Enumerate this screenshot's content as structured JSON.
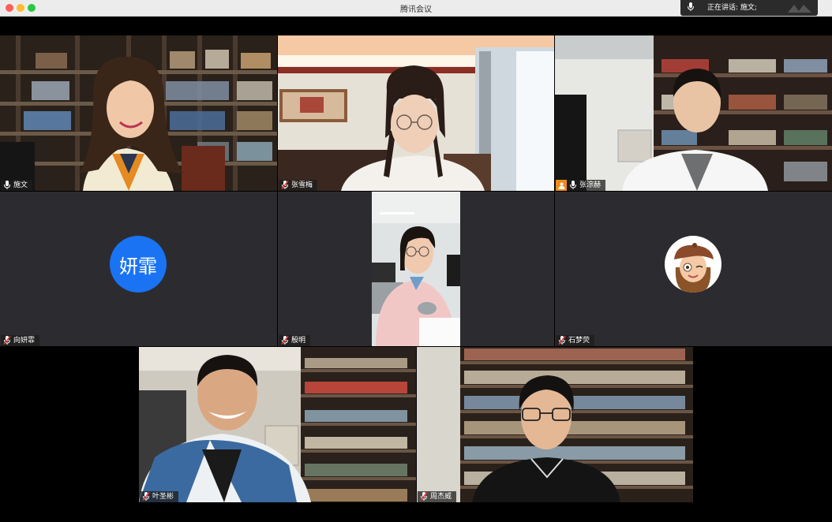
{
  "window": {
    "title": "腾讯会议"
  },
  "speaking": {
    "text": "正在讲话: 施文;"
  },
  "participants": [
    {
      "name": "施文",
      "mic": "on",
      "active": true
    },
    {
      "name": "张雪梅",
      "mic": "muted"
    },
    {
      "name": "张淙赫",
      "mic": "on",
      "flag": true
    },
    {
      "name": "向妍霏",
      "mic": "muted",
      "avatar_text": "妍霏"
    },
    {
      "name": "殷明",
      "mic": "muted"
    },
    {
      "name": "石梦荧",
      "mic": "muted",
      "avatar": "cartoon-girl-beret"
    },
    {
      "name": "叶圣彬",
      "mic": "muted"
    },
    {
      "name": "周杰威",
      "mic": "muted"
    }
  ],
  "colors": {
    "active_border": "#18c24a",
    "avatar_blue": "#1a73f3",
    "tile_bg": "#2c2c30",
    "mute_red": "#e53935"
  }
}
